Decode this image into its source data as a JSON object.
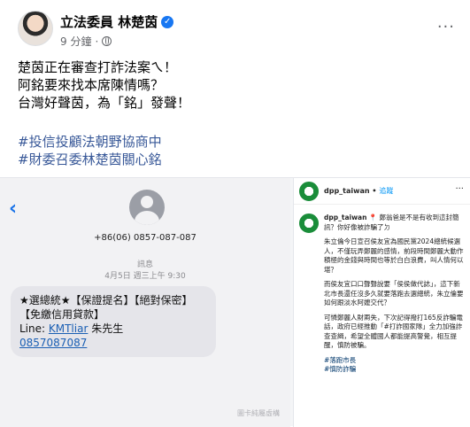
{
  "post": {
    "author": "立法委員 林楚茵",
    "time": "9 分鐘",
    "dot": "·",
    "more": "···",
    "lines": [
      "楚茵正在審查打詐法案ㄟ！",
      "阿銘要來找本席陳情嗎？",
      "台灣好聲茵，為「銘」發聲！"
    ],
    "hashtags": [
      "#投信投顧法朝野協商中",
      "#財委召委林楚茵關心銘"
    ]
  },
  "sms": {
    "back": "‹",
    "number": "+86(06) 0857-087-087",
    "label": "訊息",
    "date": "4月5日 週三上午 9:30",
    "bubble": {
      "line1": "★選總統★【保證提名】【絕對保密】【免繳信用貸款】",
      "line2_prefix": "Line: ",
      "line2_link": "KMTliar",
      "line2_suffix": " 朱先生",
      "line3_link": "0857087087"
    },
    "watermark": "圖卡純屬虛構"
  },
  "ig": {
    "top_user": "dpp_taiwan",
    "top_sep": " • ",
    "top_follow": "追蹤",
    "top_more": "···",
    "caption_user": "dpp_taiwan",
    "caption_first": "📍 鄭翁爸是不是有收到這封簡訊？你好像被詐騙了ㄉ",
    "para1": "朱立倫今日宣召侯友宜為國民黨2024總統候選人，不僅玩弄鄭麗的感情，前段時間鄭麗大動作積極的金錢與時間也等於白白浪費，叫人情何以堪？",
    "para2": "而侯友宜口口聲聲說要「侯侯做代誌」，這下新北市長還任沒多久就要落跑去選總統，朱立倫要如何跟淡水阿嬤交代？",
    "para3": "可憐鄭麗人財兩失，下次記得撥打165反詐騙電話，政府已經推動「#打詐國家隊」全力加強詐查查緝，希望全體國人都能提高警覺，相互提醒，慎防被騙。",
    "tags": [
      "#落跑市長",
      "#慎防詐騙"
    ]
  },
  "colors": {
    "fb_blue": "#1877f2",
    "hashtag": "#385898",
    "ig_follow": "#0095f6",
    "dpp_green": "#1a8d3a"
  }
}
